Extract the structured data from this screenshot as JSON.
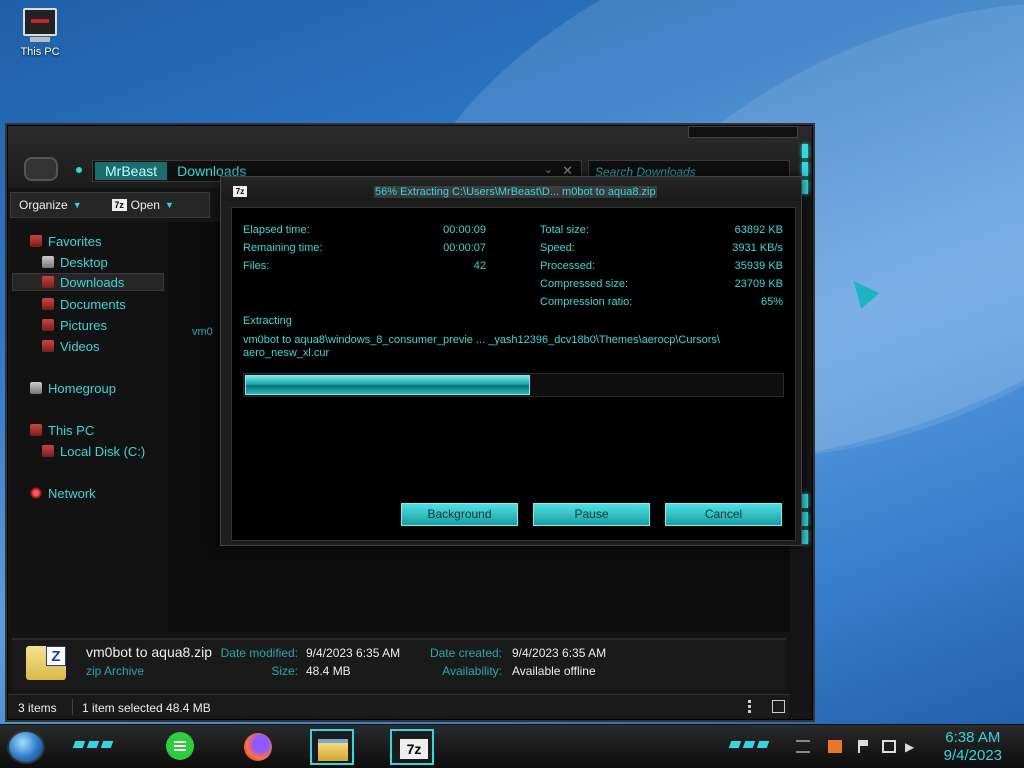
{
  "desktop": {
    "icon_label": "This PC"
  },
  "explorer": {
    "breadcrumb": [
      "MrBeast",
      "Downloads"
    ],
    "search_placeholder": "Search Downloads",
    "toolbar": {
      "organize": "Organize",
      "open": "Open"
    },
    "nav": {
      "favorites": "Favorites",
      "desktop": "Desktop",
      "downloads": "Downloads",
      "documents": "Documents",
      "pictures": "Pictures",
      "videos": "Videos",
      "homegroup": "Homegroup",
      "this_pc": "This PC",
      "local_disk": "Local Disk (C:)",
      "network": "Network"
    },
    "content_partial_file": "vm0",
    "details": {
      "file_name": "vm0bot to aqua8.zip",
      "file_type": "zip Archive",
      "date_modified_label": "Date modified:",
      "date_modified": "9/4/2023 6:35 AM",
      "size_label": "Size:",
      "size": "48.4 MB",
      "date_created_label": "Date created:",
      "date_created": "9/4/2023 6:35 AM",
      "availability_label": "Availability:",
      "availability": "Available offline"
    },
    "status": {
      "items": "3 items",
      "selected": "1 item selected  48.4 MB"
    }
  },
  "zip_dialog": {
    "title": "56% Extracting C:\\Users\\MrBeast\\D... m0bot to aqua8.zip",
    "elapsed_label": "Elapsed time:",
    "elapsed": "00:00:09",
    "remaining_label": "Remaining time:",
    "remaining": "00:00:07",
    "files_label": "Files:",
    "files": "42",
    "total_size_label": "Total size:",
    "total_size": "63892 KB",
    "speed_label": "Speed:",
    "speed": "3931 KB/s",
    "processed_label": "Processed:",
    "processed": "35939 KB",
    "compressed_label": "Compressed size:",
    "compressed": "23709 KB",
    "ratio_label": "Compression ratio:",
    "ratio": "65%",
    "action": "Extracting",
    "path_line1": "vm0bot to aqua8\\windows_8_consumer_previe ... _yash12396_dcv18b0\\Themes\\aerocp\\Cursors\\",
    "path_line2": "aero_nesw_xl.cur",
    "progress_fraction": 0.53,
    "buttons": {
      "background": "Background",
      "pause": "Pause",
      "cancel": "Cancel"
    }
  },
  "taskbar": {
    "time": "6:38 AM",
    "date": "9/4/2023"
  },
  "colors": {
    "accent": "#35d6dd",
    "window_bg": "#151515"
  }
}
